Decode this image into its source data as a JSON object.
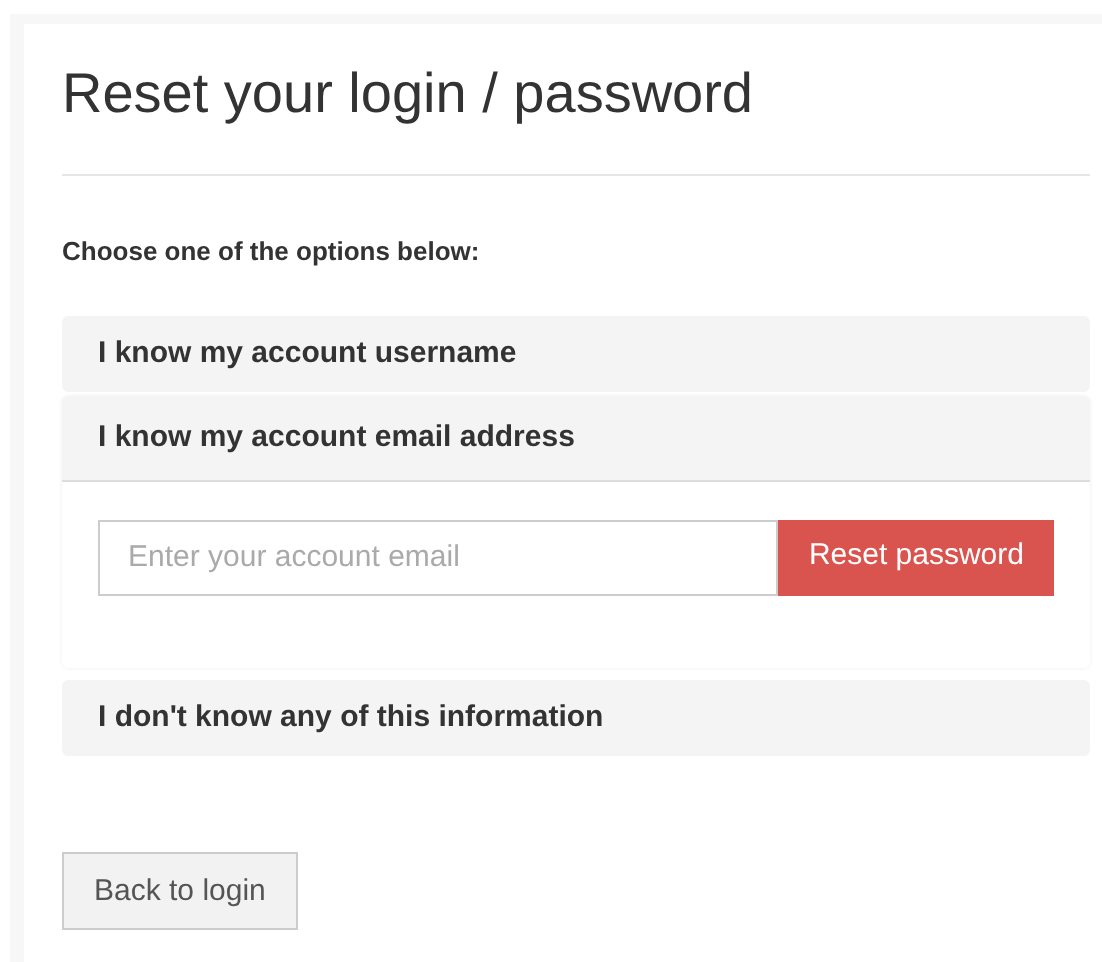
{
  "title": "Reset your login / password",
  "instructions": "Choose one of the options below:",
  "options": [
    {
      "label": "I know my account username",
      "expanded": false
    },
    {
      "label": "I know my account email address",
      "expanded": true,
      "field": {
        "placeholder": "Enter your account email"
      },
      "button": "Reset password"
    },
    {
      "label": "I don't know any of this information",
      "expanded": false
    }
  ],
  "back_button": "Back to login"
}
